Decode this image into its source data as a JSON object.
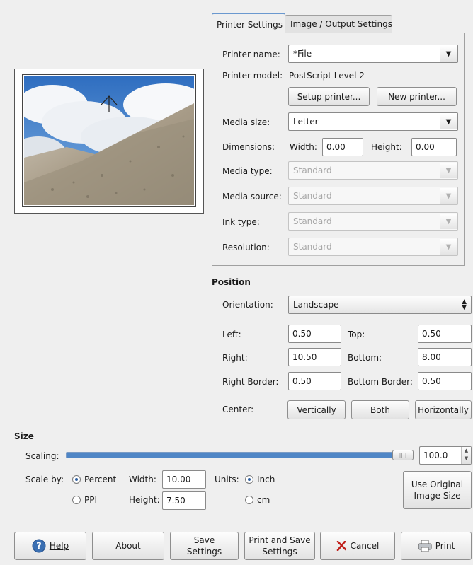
{
  "tabs": [
    {
      "label": "Printer Settings",
      "active": true
    },
    {
      "label": "Image / Output Settings",
      "active": false
    }
  ],
  "printer": {
    "name_label": "Printer name:",
    "name_value": "*File",
    "model_label": "Printer model:",
    "model_value": "PostScript Level 2",
    "setup_button": "Setup printer...",
    "new_button": "New printer...",
    "media_size_label": "Media size:",
    "media_size_value": "Letter",
    "dimensions_label": "Dimensions:",
    "width_label": "Width:",
    "width_value": "0.00",
    "height_label": "Height:",
    "height_value": "0.00",
    "media_type_label": "Media type:",
    "media_type_value": "Standard",
    "media_source_label": "Media source:",
    "media_source_value": "Standard",
    "ink_type_label": "Ink type:",
    "ink_type_value": "Standard",
    "resolution_label": "Resolution:",
    "resolution_value": "Standard"
  },
  "position": {
    "title": "Position",
    "orientation_label": "Orientation:",
    "orientation_value": "Landscape",
    "left_label": "Left:",
    "left_value": "0.50",
    "top_label": "Top:",
    "top_value": "0.50",
    "right_label": "Right:",
    "right_value": "10.50",
    "bottom_label": "Bottom:",
    "bottom_value": "8.00",
    "right_border_label": "Right Border:",
    "right_border_value": "0.50",
    "bottom_border_label": "Bottom Border:",
    "bottom_border_value": "0.50",
    "center_label": "Center:",
    "vertically_button": "Vertically",
    "both_button": "Both",
    "horizontally_button": "Horizontally"
  },
  "size": {
    "title": "Size",
    "scaling_label": "Scaling:",
    "scaling_value": "100.0",
    "scaling_fraction": 1.0,
    "scale_by_label": "Scale by:",
    "percent_label": "Percent",
    "ppi_label": "PPI",
    "scale_by_selected": "Percent",
    "width_label": "Width:",
    "width_value": "10.00",
    "height_label": "Height:",
    "height_value": "7.50",
    "units_label": "Units:",
    "inch_label": "Inch",
    "cm_label": "cm",
    "units_selected": "Inch",
    "use_original_button": "Use Original Image Size"
  },
  "buttons": {
    "help": "Help",
    "about": "About",
    "save_settings": "Save Settings",
    "print_and_save": "Print and Save Settings",
    "cancel": "Cancel",
    "print": "Print"
  },
  "icons": {
    "help": "help-icon",
    "cancel": "cancel-x-icon",
    "print": "printer-icon",
    "combo_arrow": "chevron-down-icon",
    "preview_arrow": "up-arrow-icon"
  },
  "colors": {
    "slider_fill": "#4f86c6",
    "help_icon": "#3a6fb2",
    "cancel_icon": "#c0201b",
    "accent_radio": "#2e5fa0"
  }
}
